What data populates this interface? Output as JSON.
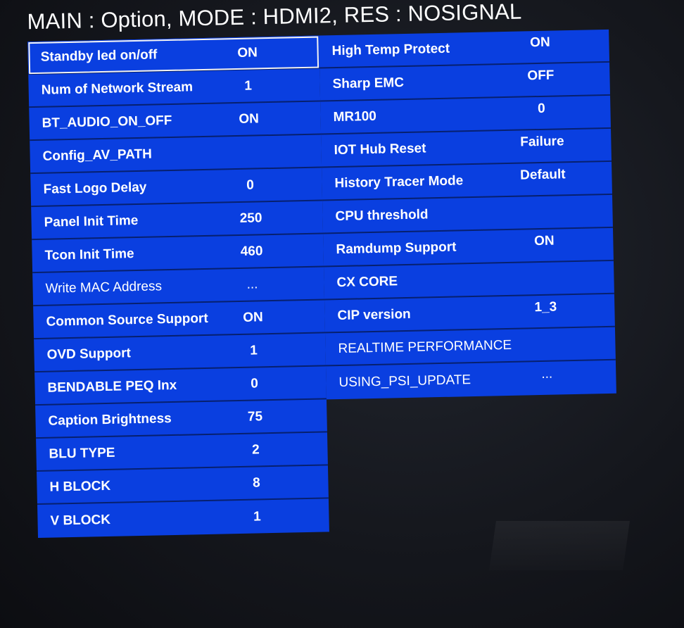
{
  "header": {
    "title": "MAIN : Option, MODE : HDMI2, RES : NOSIGNAL"
  },
  "left_column": [
    {
      "label": "Standby led on/off",
      "value": "ON"
    },
    {
      "label": "Num of Network Stream",
      "value": "1"
    },
    {
      "label": "BT_AUDIO_ON_OFF",
      "value": "ON"
    },
    {
      "label": "Config_AV_PATH",
      "value": ""
    },
    {
      "label": "Fast Logo Delay",
      "value": "0"
    },
    {
      "label": "Panel Init Time",
      "value": "250"
    },
    {
      "label": "Tcon Init Time",
      "value": "460"
    },
    {
      "label": "Write MAC Address",
      "value": "..."
    },
    {
      "label": "Common Source Support",
      "value": "ON"
    },
    {
      "label": "OVD Support",
      "value": "1"
    },
    {
      "label": "BENDABLE PEQ Inx",
      "value": "0"
    },
    {
      "label": "Caption Brightness",
      "value": "75"
    },
    {
      "label": "BLU TYPE",
      "value": "2"
    },
    {
      "label": "H BLOCK",
      "value": "8"
    },
    {
      "label": "V BLOCK",
      "value": "1"
    }
  ],
  "right_column": [
    {
      "label": "High Temp Protect",
      "value": "ON"
    },
    {
      "label": "Sharp EMC",
      "value": "OFF"
    },
    {
      "label": "MR100",
      "value": "0"
    },
    {
      "label": "IOT Hub Reset",
      "value": "Failure"
    },
    {
      "label": "History Tracer Mode",
      "value": "Default"
    },
    {
      "label": "CPU threshold",
      "value": ""
    },
    {
      "label": "Ramdump Support",
      "value": "ON"
    },
    {
      "label": "CX CORE",
      "value": ""
    },
    {
      "label": "CIP version",
      "value": "1_3"
    },
    {
      "label": "REALTIME PERFORMANCE",
      "value": ""
    },
    {
      "label": "USING_PSI_UPDATE",
      "value": "..."
    }
  ],
  "selected_item": "Standby led on/off",
  "colors": {
    "row_background": "#0a3fe0",
    "row_divider": "#07206f",
    "text": "#ffffff",
    "selection_border": "#f3f3f3",
    "screen_background": "#15171d"
  }
}
